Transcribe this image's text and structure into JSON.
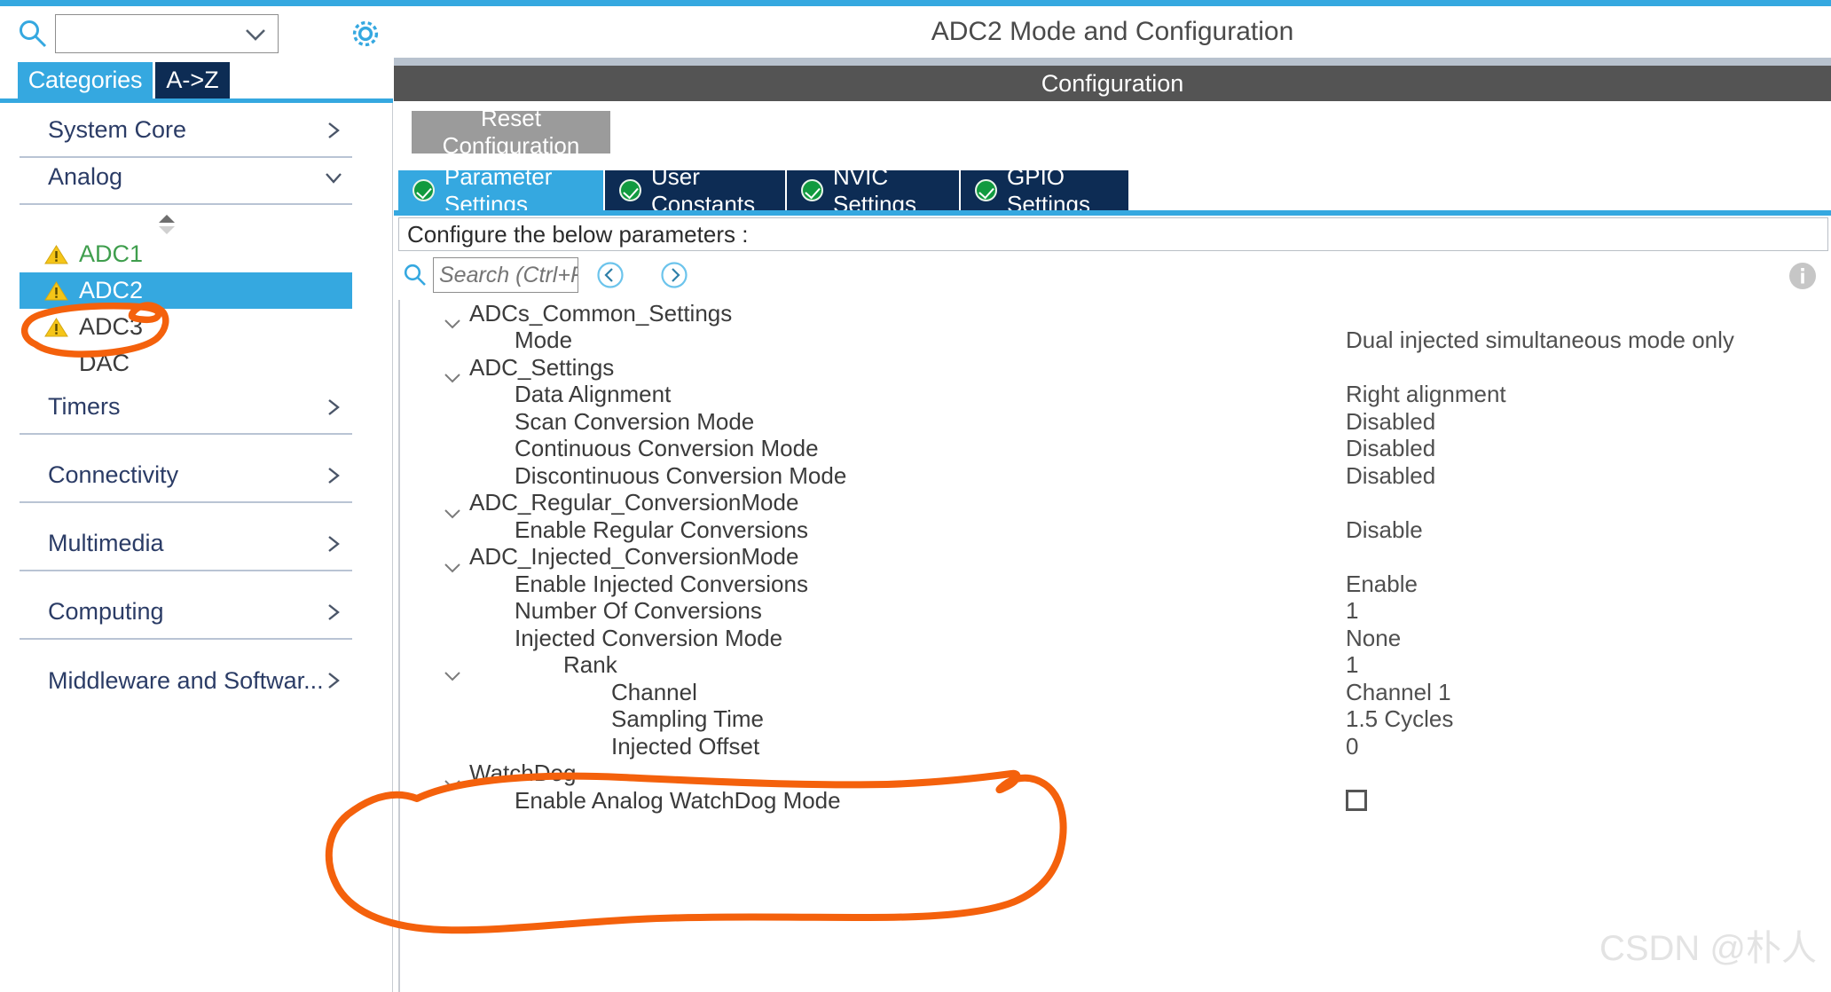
{
  "colors": {
    "accent_cyan": "#35a8e0",
    "navy": "#0d2c54",
    "annotation_orange": "#f4610c",
    "config_bar_gray": "#545454",
    "warning_yellow": "#f5c518",
    "ok_green": "#119a3f"
  },
  "left_panel": {
    "search": {
      "value": "",
      "placeholder": ""
    },
    "search_icon": "search-icon",
    "gear_icon": "gear-icon",
    "tabs": [
      {
        "label": "Categories",
        "active": true
      },
      {
        "label": "A->Z",
        "active": false
      }
    ],
    "categories": [
      {
        "label": "System Core",
        "expanded": false,
        "chevron": "chevron-right-icon"
      },
      {
        "label": "Analog",
        "expanded": true,
        "chevron": "chevron-down-icon"
      },
      {
        "label": "Timers",
        "expanded": false,
        "chevron": "chevron-right-icon"
      },
      {
        "label": "Connectivity",
        "expanded": false,
        "chevron": "chevron-right-icon"
      },
      {
        "label": "Multimedia",
        "expanded": false,
        "chevron": "chevron-right-icon"
      },
      {
        "label": "Computing",
        "expanded": false,
        "chevron": "chevron-right-icon"
      },
      {
        "label": "Middleware and Softwar...",
        "expanded": false,
        "chevron": "chevron-right-icon"
      }
    ],
    "analog_devices": [
      {
        "label": "ADC1",
        "warning": true,
        "selected": false,
        "state": "green"
      },
      {
        "label": "ADC2",
        "warning": true,
        "selected": true,
        "state": "selected"
      },
      {
        "label": "ADC3",
        "warning": true,
        "selected": false,
        "state": "normal"
      },
      {
        "label": "DAC",
        "warning": false,
        "selected": false,
        "state": "normal"
      }
    ]
  },
  "right_panel": {
    "title": "ADC2 Mode and Configuration",
    "config_bar": "Configuration",
    "reset_button": "Reset Configuration",
    "tabs": [
      {
        "label": "Parameter Settings",
        "active": true,
        "badge": "check-ok-icon"
      },
      {
        "label": "User Constants",
        "active": false,
        "badge": "check-ok-icon"
      },
      {
        "label": "NVIC Settings",
        "active": false,
        "badge": "check-ok-icon"
      },
      {
        "label": "GPIO Settings",
        "active": false,
        "badge": "check-ok-icon"
      }
    ],
    "configure_hint": "Configure the below parameters :",
    "param_search": {
      "value": "",
      "placeholder": "Search (Ctrl+F)"
    },
    "nav_prev_icon": "chevron-left-circle-icon",
    "nav_next_icon": "chevron-right-circle-icon",
    "info_icon": "info-icon",
    "parameters": [
      {
        "name": "ADCs_Common_Settings",
        "value": "",
        "level": "group",
        "expanded": true
      },
      {
        "name": "Mode",
        "value": "Dual injected simultaneous mode only",
        "level": "l1"
      },
      {
        "name": "ADC_Settings",
        "value": "",
        "level": "group",
        "expanded": true
      },
      {
        "name": "Data Alignment",
        "value": "Right alignment",
        "level": "l1"
      },
      {
        "name": "Scan Conversion Mode",
        "value": "Disabled",
        "level": "l1"
      },
      {
        "name": "Continuous Conversion Mode",
        "value": "Disabled",
        "level": "l1"
      },
      {
        "name": "Discontinuous Conversion Mode",
        "value": "Disabled",
        "level": "l1"
      },
      {
        "name": "ADC_Regular_ConversionMode",
        "value": "",
        "level": "group",
        "expanded": true
      },
      {
        "name": "Enable Regular Conversions",
        "value": "Disable",
        "level": "l1"
      },
      {
        "name": "ADC_Injected_ConversionMode",
        "value": "",
        "level": "group",
        "expanded": true
      },
      {
        "name": "Enable Injected Conversions",
        "value": "Enable",
        "level": "l1"
      },
      {
        "name": "Number Of Conversions",
        "value": "1",
        "level": "l1"
      },
      {
        "name": "Injected Conversion Mode",
        "value": "None",
        "level": "l1"
      },
      {
        "name": "Rank",
        "value": "1",
        "level": "l1",
        "expanded": true,
        "has_chevron": true
      },
      {
        "name": "Channel",
        "value": "Channel 1",
        "level": "l2"
      },
      {
        "name": "Sampling Time",
        "value": "1.5 Cycles",
        "level": "l2"
      },
      {
        "name": "Injected Offset",
        "value": "0",
        "level": "l2"
      },
      {
        "name": "WatchDog",
        "value": "",
        "level": "group",
        "expanded": true
      },
      {
        "name": "Enable Analog WatchDog Mode",
        "value": "",
        "level": "l1",
        "checkbox": false
      }
    ]
  },
  "annotations": [
    {
      "name": "adc2-circle",
      "shape": "hand-drawn-ellipse",
      "target": "ADC2"
    },
    {
      "name": "rank-block-circle",
      "shape": "hand-drawn-ellipse",
      "target": "Rank group rows"
    }
  ],
  "watermark": "CSDN @朴人"
}
